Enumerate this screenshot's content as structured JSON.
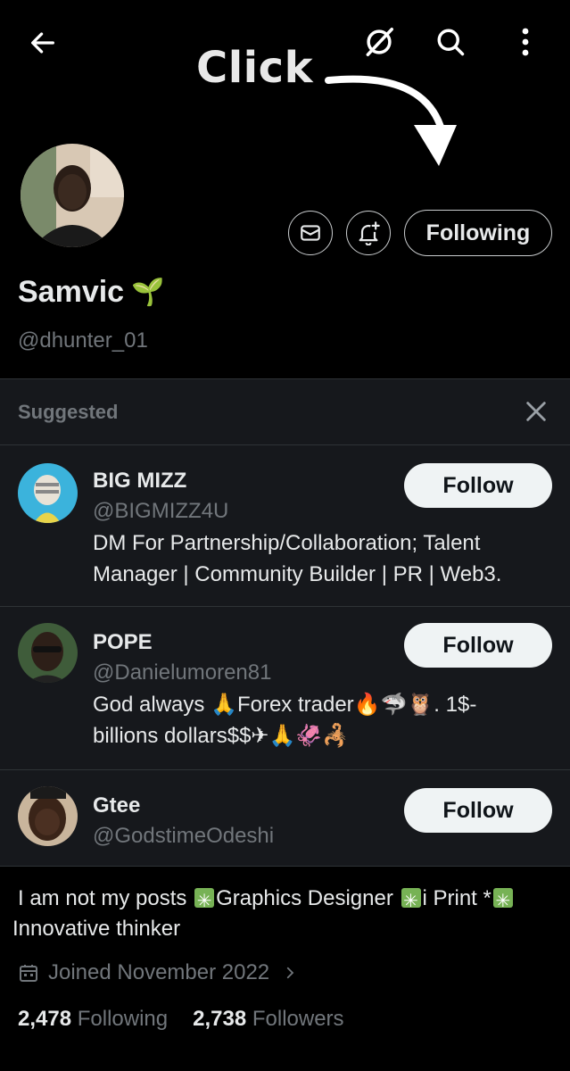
{
  "annotation": {
    "text": "Click"
  },
  "profile": {
    "name": "Samvic",
    "name_emoji": "🌱",
    "handle": "@dhunter_01",
    "follow_state": "Following",
    "bio_parts": [
      "I am not my posts ",
      "Graphics Designer ",
      "i Print *",
      " Innovative thinker"
    ],
    "joined": "Joined November 2022",
    "following_count": "2,478",
    "following_label": "Following",
    "followers_count": "2,738",
    "followers_label": "Followers"
  },
  "suggested": {
    "title": "Suggested",
    "items": [
      {
        "name": "BIG MIZZ",
        "handle": "@BIGMIZZ4U",
        "bio_line1": "DM For Partnership/Collaboration; Talent",
        "bio_line2": "Manager | Community Builder | PR | Web3.",
        "button": "Follow"
      },
      {
        "name": "POPE",
        "handle": "@Danielumoren81",
        "bio_line1": "God always 🙏Forex trader🔥🦈🦉. 1$-",
        "bio_line2": "billions dollars$$✈🙏🦑🦂",
        "button": "Follow"
      },
      {
        "name": "Gtee",
        "handle": "@GodstimeOdeshi",
        "button": "Follow"
      }
    ]
  },
  "colors": {
    "background": "#000000",
    "panel": "#16181c",
    "text_primary": "#e7e9ea",
    "text_secondary": "#71767b",
    "button_bg": "#eff3f4"
  },
  "icons": [
    "back-arrow-icon",
    "grok-icon",
    "search-icon",
    "more-vertical-icon",
    "mail-icon",
    "bell-plus-icon",
    "close-icon",
    "calendar-icon",
    "chevron-right-icon"
  ]
}
